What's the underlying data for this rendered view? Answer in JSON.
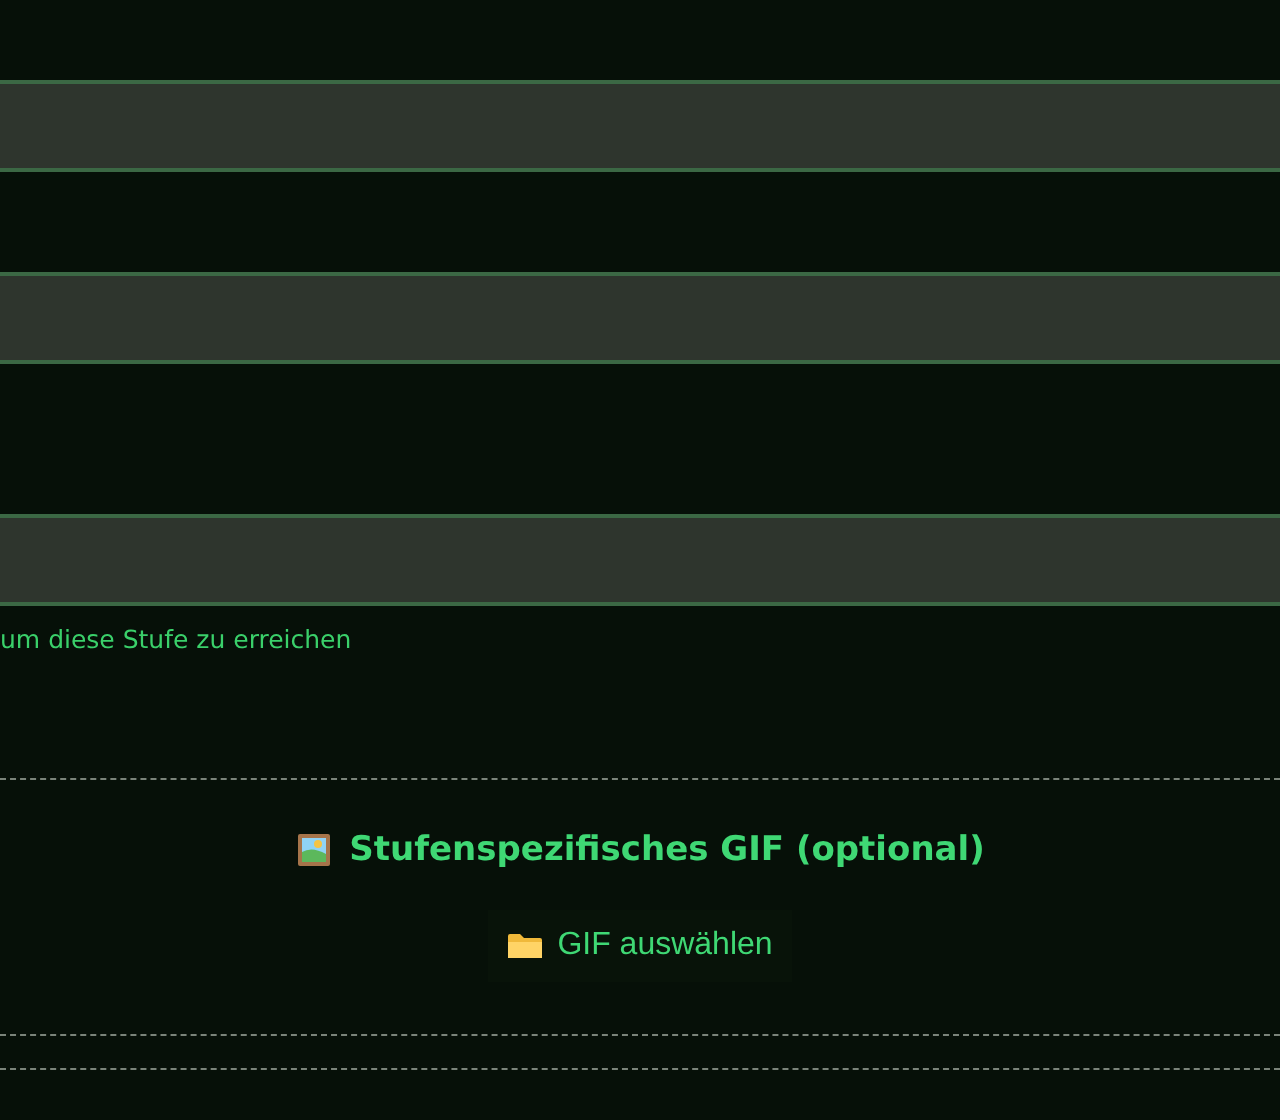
{
  "fields": [
    {
      "kind": "text"
    },
    {
      "kind": "text"
    },
    {
      "kind": "text"
    }
  ],
  "hint": "um diese Stufe zu erreichen",
  "gif_section": {
    "title": "Stufenspezifisches GIF (optional)",
    "button": "GIF auswählen"
  }
}
